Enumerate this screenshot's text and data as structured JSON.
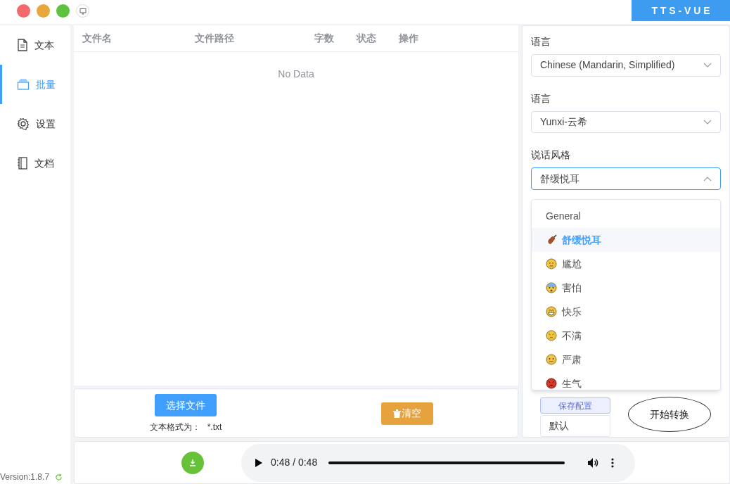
{
  "window": {
    "brand": "T T S - V U E"
  },
  "sidebar": {
    "items": [
      {
        "label": "文本",
        "selected": false
      },
      {
        "label": "批量",
        "selected": true
      },
      {
        "label": "设置",
        "selected": false
      },
      {
        "label": "文档",
        "selected": false
      }
    ],
    "version": "Version:1.8.7"
  },
  "table": {
    "columns": [
      "文件名",
      "文件路径",
      "字数",
      "状态",
      "操作"
    ],
    "empty_text": "No Data"
  },
  "actions": {
    "select_button": "选择文件",
    "format_label": "文本格式为：",
    "format_value": "*.txt",
    "clear_button": "清空"
  },
  "player": {
    "time": "0:48 / 0:48",
    "level": 1
  },
  "settings": {
    "fields": [
      {
        "label": "语言",
        "value": "Chinese (Mandarin, Simplified)",
        "expanded": false
      },
      {
        "label": "语言",
        "value": "Yunxi-云希",
        "expanded": false
      },
      {
        "label": "说话风格",
        "value": "舒缓悦耳",
        "expanded": true
      }
    ],
    "dropdown": {
      "group": "General",
      "options": [
        {
          "label": "舒缓悦耳",
          "selected": true
        },
        {
          "label": "尴尬",
          "selected": false
        },
        {
          "label": "害怕",
          "selected": false
        },
        {
          "label": "快乐",
          "selected": false
        },
        {
          "label": "不满",
          "selected": false
        },
        {
          "label": "严肃",
          "selected": false
        },
        {
          "label": "生气",
          "selected": false
        }
      ]
    },
    "save_button": "保存配置",
    "default_button": "默认",
    "start_button": "开始转换"
  }
}
